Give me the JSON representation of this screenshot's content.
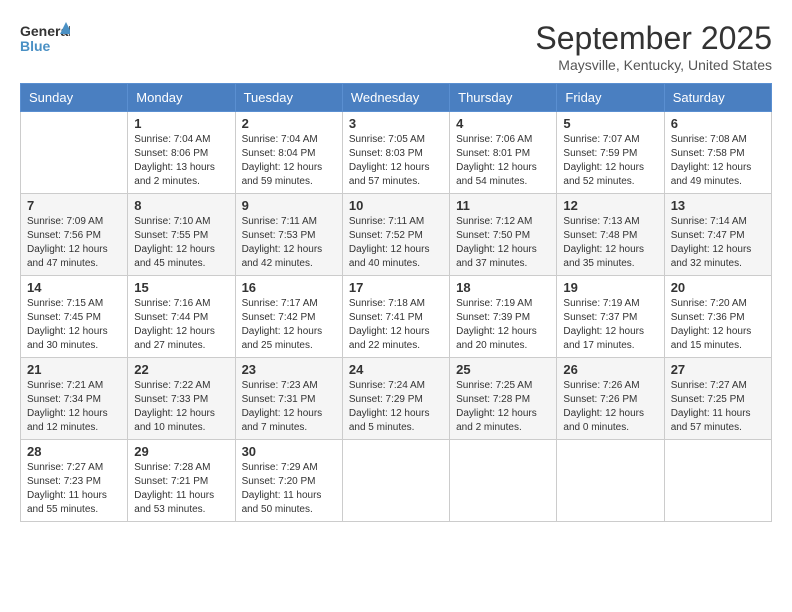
{
  "logo": {
    "line1": "General",
    "line2": "Blue"
  },
  "title": "September 2025",
  "location": "Maysville, Kentucky, United States",
  "weekdays": [
    "Sunday",
    "Monday",
    "Tuesday",
    "Wednesday",
    "Thursday",
    "Friday",
    "Saturday"
  ],
  "weeks": [
    [
      {
        "day": "",
        "info": ""
      },
      {
        "day": "1",
        "info": "Sunrise: 7:04 AM\nSunset: 8:06 PM\nDaylight: 13 hours\nand 2 minutes."
      },
      {
        "day": "2",
        "info": "Sunrise: 7:04 AM\nSunset: 8:04 PM\nDaylight: 12 hours\nand 59 minutes."
      },
      {
        "day": "3",
        "info": "Sunrise: 7:05 AM\nSunset: 8:03 PM\nDaylight: 12 hours\nand 57 minutes."
      },
      {
        "day": "4",
        "info": "Sunrise: 7:06 AM\nSunset: 8:01 PM\nDaylight: 12 hours\nand 54 minutes."
      },
      {
        "day": "5",
        "info": "Sunrise: 7:07 AM\nSunset: 7:59 PM\nDaylight: 12 hours\nand 52 minutes."
      },
      {
        "day": "6",
        "info": "Sunrise: 7:08 AM\nSunset: 7:58 PM\nDaylight: 12 hours\nand 49 minutes."
      }
    ],
    [
      {
        "day": "7",
        "info": "Sunrise: 7:09 AM\nSunset: 7:56 PM\nDaylight: 12 hours\nand 47 minutes."
      },
      {
        "day": "8",
        "info": "Sunrise: 7:10 AM\nSunset: 7:55 PM\nDaylight: 12 hours\nand 45 minutes."
      },
      {
        "day": "9",
        "info": "Sunrise: 7:11 AM\nSunset: 7:53 PM\nDaylight: 12 hours\nand 42 minutes."
      },
      {
        "day": "10",
        "info": "Sunrise: 7:11 AM\nSunset: 7:52 PM\nDaylight: 12 hours\nand 40 minutes."
      },
      {
        "day": "11",
        "info": "Sunrise: 7:12 AM\nSunset: 7:50 PM\nDaylight: 12 hours\nand 37 minutes."
      },
      {
        "day": "12",
        "info": "Sunrise: 7:13 AM\nSunset: 7:48 PM\nDaylight: 12 hours\nand 35 minutes."
      },
      {
        "day": "13",
        "info": "Sunrise: 7:14 AM\nSunset: 7:47 PM\nDaylight: 12 hours\nand 32 minutes."
      }
    ],
    [
      {
        "day": "14",
        "info": "Sunrise: 7:15 AM\nSunset: 7:45 PM\nDaylight: 12 hours\nand 30 minutes."
      },
      {
        "day": "15",
        "info": "Sunrise: 7:16 AM\nSunset: 7:44 PM\nDaylight: 12 hours\nand 27 minutes."
      },
      {
        "day": "16",
        "info": "Sunrise: 7:17 AM\nSunset: 7:42 PM\nDaylight: 12 hours\nand 25 minutes."
      },
      {
        "day": "17",
        "info": "Sunrise: 7:18 AM\nSunset: 7:41 PM\nDaylight: 12 hours\nand 22 minutes."
      },
      {
        "day": "18",
        "info": "Sunrise: 7:19 AM\nSunset: 7:39 PM\nDaylight: 12 hours\nand 20 minutes."
      },
      {
        "day": "19",
        "info": "Sunrise: 7:19 AM\nSunset: 7:37 PM\nDaylight: 12 hours\nand 17 minutes."
      },
      {
        "day": "20",
        "info": "Sunrise: 7:20 AM\nSunset: 7:36 PM\nDaylight: 12 hours\nand 15 minutes."
      }
    ],
    [
      {
        "day": "21",
        "info": "Sunrise: 7:21 AM\nSunset: 7:34 PM\nDaylight: 12 hours\nand 12 minutes."
      },
      {
        "day": "22",
        "info": "Sunrise: 7:22 AM\nSunset: 7:33 PM\nDaylight: 12 hours\nand 10 minutes."
      },
      {
        "day": "23",
        "info": "Sunrise: 7:23 AM\nSunset: 7:31 PM\nDaylight: 12 hours\nand 7 minutes."
      },
      {
        "day": "24",
        "info": "Sunrise: 7:24 AM\nSunset: 7:29 PM\nDaylight: 12 hours\nand 5 minutes."
      },
      {
        "day": "25",
        "info": "Sunrise: 7:25 AM\nSunset: 7:28 PM\nDaylight: 12 hours\nand 2 minutes."
      },
      {
        "day": "26",
        "info": "Sunrise: 7:26 AM\nSunset: 7:26 PM\nDaylight: 12 hours\nand 0 minutes."
      },
      {
        "day": "27",
        "info": "Sunrise: 7:27 AM\nSunset: 7:25 PM\nDaylight: 11 hours\nand 57 minutes."
      }
    ],
    [
      {
        "day": "28",
        "info": "Sunrise: 7:27 AM\nSunset: 7:23 PM\nDaylight: 11 hours\nand 55 minutes."
      },
      {
        "day": "29",
        "info": "Sunrise: 7:28 AM\nSunset: 7:21 PM\nDaylight: 11 hours\nand 53 minutes."
      },
      {
        "day": "30",
        "info": "Sunrise: 7:29 AM\nSunset: 7:20 PM\nDaylight: 11 hours\nand 50 minutes."
      },
      {
        "day": "",
        "info": ""
      },
      {
        "day": "",
        "info": ""
      },
      {
        "day": "",
        "info": ""
      },
      {
        "day": "",
        "info": ""
      }
    ]
  ]
}
